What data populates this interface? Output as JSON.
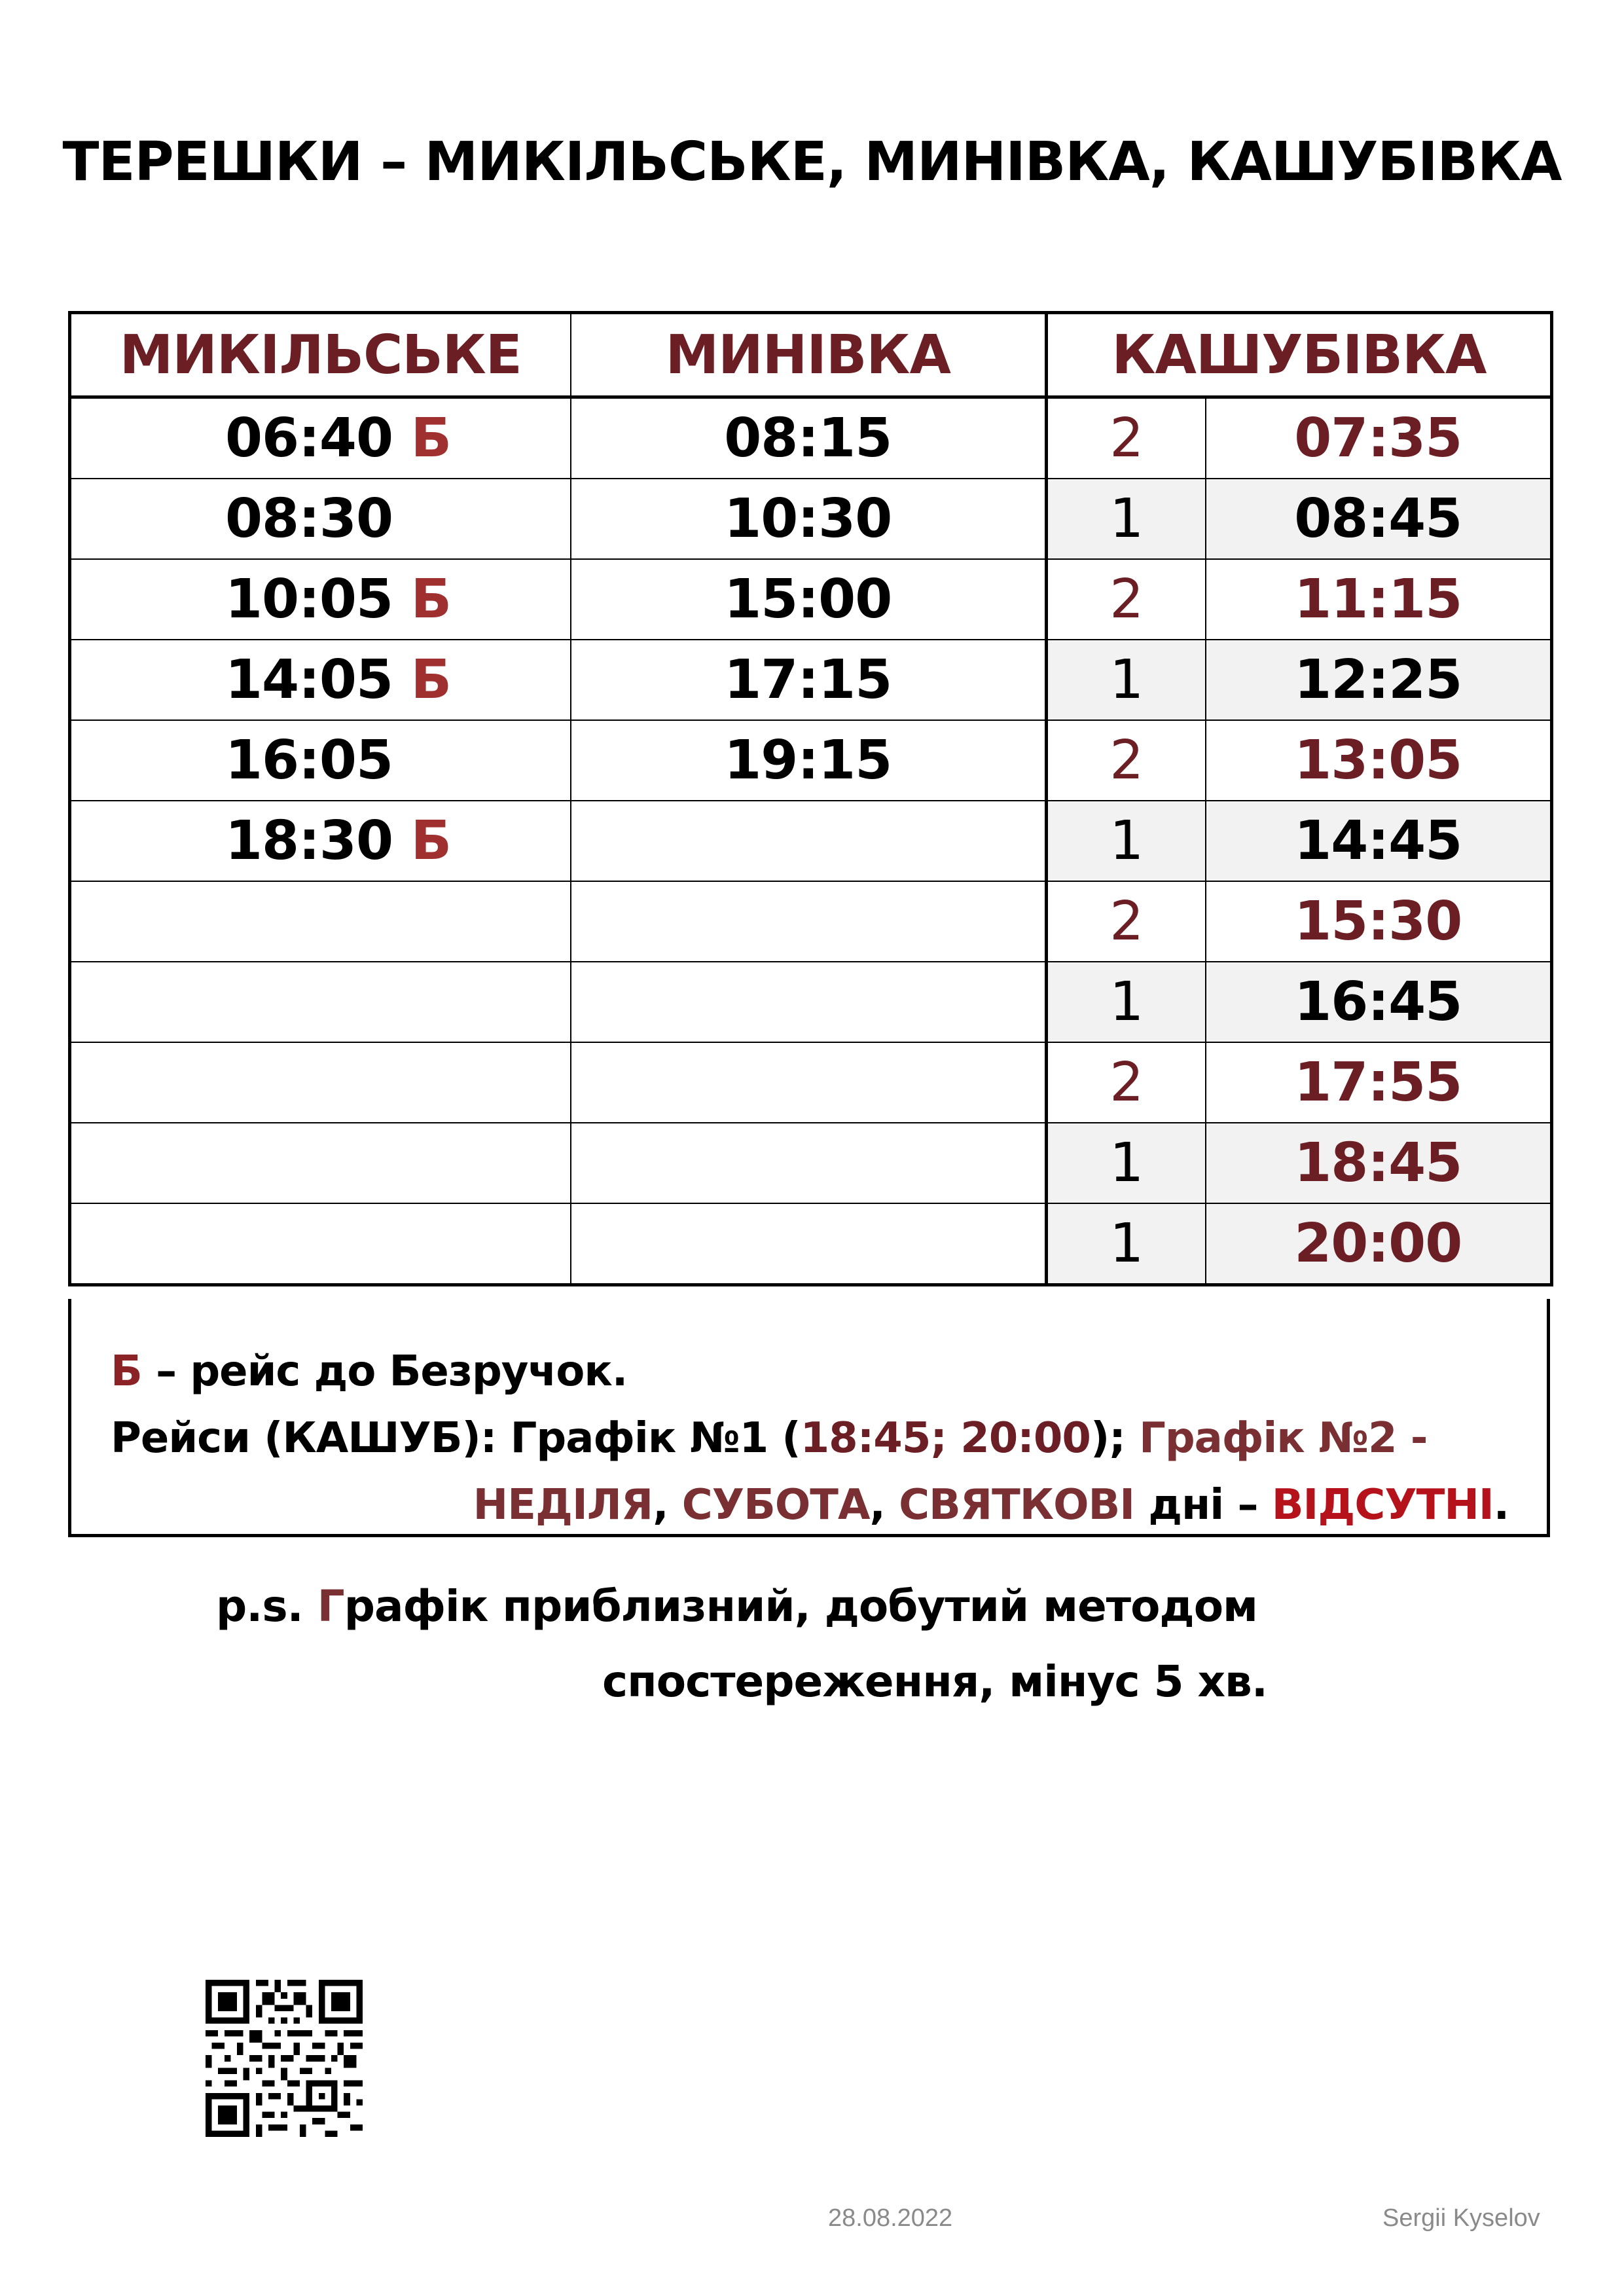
{
  "title": "ТЕРЕШКИ – МИКІЛЬСЬКЕ, МИНІВКА, КАШУБІВКА",
  "columns": {
    "mykilske": "МИКІЛЬСЬКЕ",
    "mynivka": "МИНІВКА",
    "kashubivka": "КАШУБІВКА"
  },
  "rows": [
    {
      "m_time": "06:40",
      "m_flag": "Б",
      "n_time": "08:15",
      "k_route": "2",
      "k_time": "07:35"
    },
    {
      "m_time": "08:30",
      "m_flag": "",
      "n_time": "10:30",
      "k_route": "1",
      "k_time": "08:45"
    },
    {
      "m_time": "10:05",
      "m_flag": "Б",
      "n_time": "15:00",
      "k_route": "2",
      "k_time": "11:15"
    },
    {
      "m_time": "14:05",
      "m_flag": "Б",
      "n_time": "17:15",
      "k_route": "1",
      "k_time": "12:25"
    },
    {
      "m_time": "16:05",
      "m_flag": "",
      "n_time": "19:15",
      "k_route": "2",
      "k_time": "13:05"
    },
    {
      "m_time": "18:30",
      "m_flag": "Б",
      "n_time": "",
      "k_route": "1",
      "k_time": "14:45"
    },
    {
      "m_time": "",
      "m_flag": "",
      "n_time": "",
      "k_route": "2",
      "k_time": "15:30"
    },
    {
      "m_time": "",
      "m_flag": "",
      "n_time": "",
      "k_route": "1",
      "k_time": "16:45"
    },
    {
      "m_time": "",
      "m_flag": "",
      "n_time": "",
      "k_route": "2",
      "k_time": "17:55"
    },
    {
      "m_time": "",
      "m_flag": "",
      "n_time": "",
      "k_route": "1",
      "k_time": "18:45"
    },
    {
      "m_time": "",
      "m_flag": "",
      "n_time": "",
      "k_route": "1",
      "k_time": "20:00"
    }
  ],
  "notes": {
    "line1_flag": "Б",
    "line1_text": " – рейс до Безручок.",
    "line2_prefix": "Рейси (КАШУБ): Графік №1 (",
    "line2_times": "18:45; 20:00",
    "line2_mid": "); ",
    "line2_suffix": "Графік №2 -",
    "line3_sunday": "НЕДІЛЯ",
    "line3_comma1": ", ",
    "line3_saturday": "СУБОТА",
    "line3_comma2": ", ",
    "line3_holiday": "СВЯТКОВІ",
    "line3_days": " дні – ",
    "line3_absent": "ВІДСУТНІ",
    "line3_dot": "."
  },
  "ps": {
    "prefix": "p.s. ",
    "g_letter": "Г",
    "line1_rest": "рафік приблизний, добутий методом",
    "line2": "спостереження, мінус 5 хв."
  },
  "footer": {
    "date": "28.08.2022",
    "author": "Sergii Kyselov"
  },
  "colors": {
    "header_red": "#6b1f24",
    "flag_red": "#a03030",
    "absent_red": "#b5121b",
    "shade_gray": "#f2f2f2"
  },
  "icons": {
    "qr": "qr-code-icon"
  }
}
